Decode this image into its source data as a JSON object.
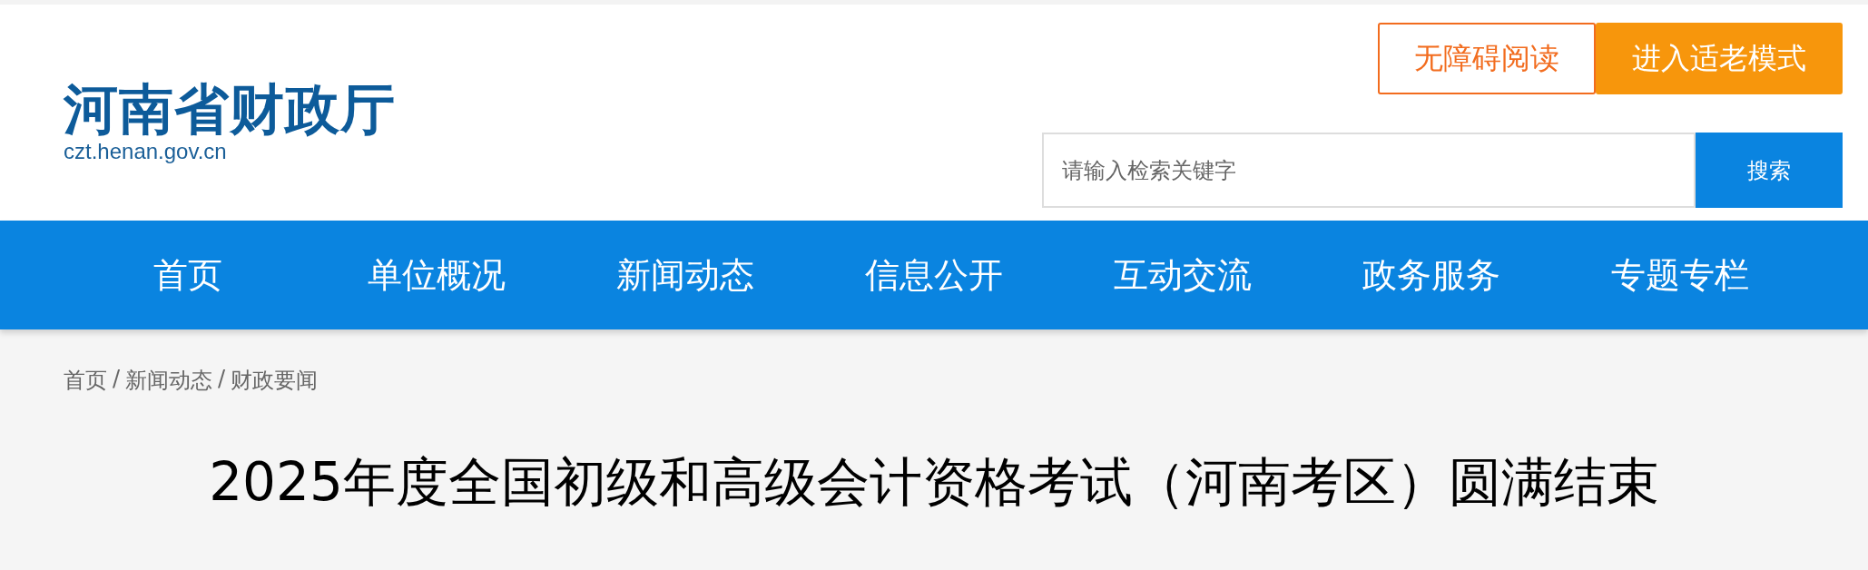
{
  "header": {
    "site_name": "河南省财政厅",
    "domain": "czt.henan.gov.cn",
    "buttons": [
      {
        "label": "无障碍阅读",
        "kind": "outline"
      },
      {
        "label": "进入适老模式",
        "kind": "filled"
      }
    ],
    "search": {
      "placeholder": "请输入检索关键字",
      "button": "搜索"
    }
  },
  "nav": [
    "首页",
    "单位概况",
    "新闻动态",
    "信息公开",
    "互动交流",
    "政务服务",
    "专题专栏"
  ],
  "breadcrumb": {
    "items": [
      "首页",
      "新闻动态",
      "财政要闻"
    ],
    "separator": "/"
  },
  "article": {
    "title": "2025年度全国初级和高级会计资格考试（河南考区）圆满结束"
  }
}
